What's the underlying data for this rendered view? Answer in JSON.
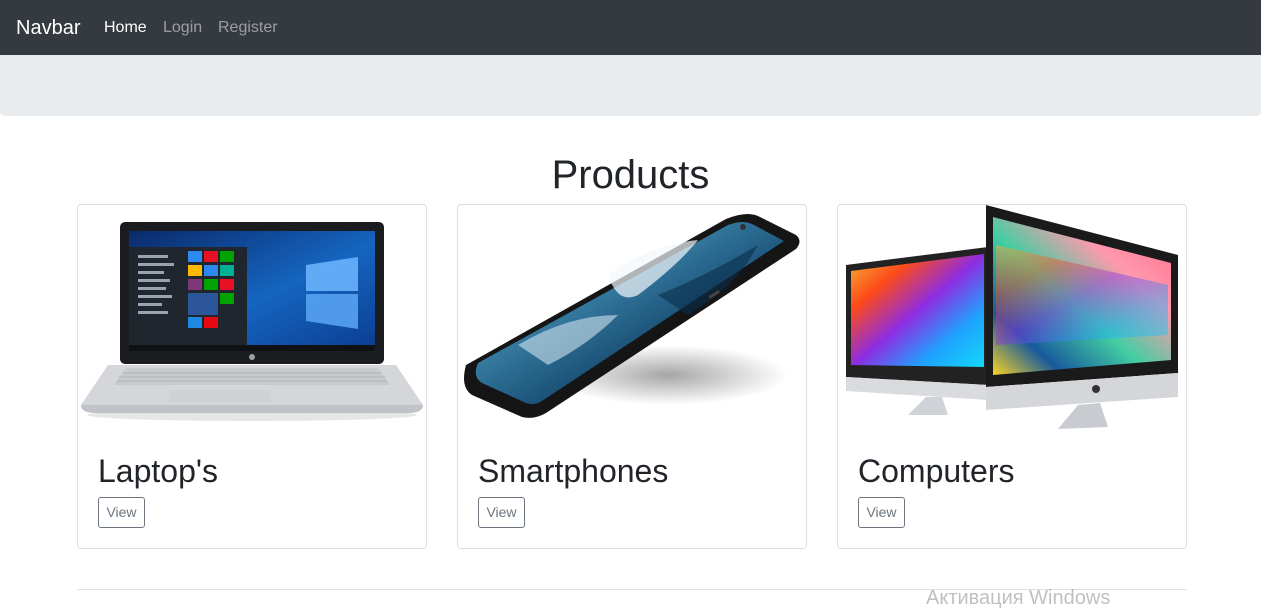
{
  "navbar": {
    "brand": "Navbar",
    "links": [
      {
        "label": "Home",
        "active": true
      },
      {
        "label": "Login",
        "active": false
      },
      {
        "label": "Register",
        "active": false
      }
    ]
  },
  "main": {
    "title": "Products",
    "cards": [
      {
        "title": "Laptop's",
        "button": "View",
        "image": "laptop-image"
      },
      {
        "title": "Smartphones",
        "button": "View",
        "image": "smartphone-image"
      },
      {
        "title": "Computers",
        "button": "View",
        "image": "computers-image"
      }
    ]
  },
  "watermark": "Активация Windows",
  "colors": {
    "navbar_bg": "#343a40",
    "jumbotron_bg": "#e9ecef",
    "button_border": "#6c757d"
  }
}
